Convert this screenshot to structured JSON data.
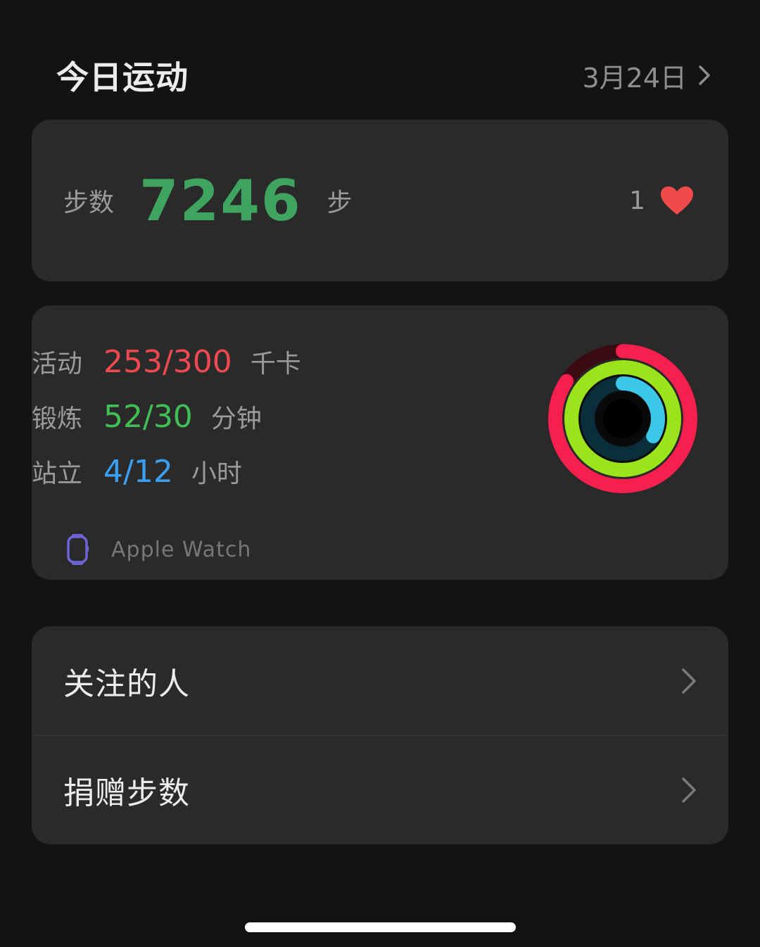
{
  "header": {
    "title": "今日运动",
    "date": "3月24日"
  },
  "steps": {
    "label": "步数",
    "value": "7246",
    "unit": "步",
    "likes": "1"
  },
  "activity": {
    "move": {
      "label": "活动",
      "value": "253/300",
      "unit": "千卡",
      "current": 253,
      "goal": 300,
      "color": "#f0494f"
    },
    "exercise": {
      "label": "锻炼",
      "value": "52/30",
      "unit": "分钟",
      "current": 52,
      "goal": 30,
      "color": "#3fbf55"
    },
    "stand": {
      "label": "站立",
      "value": "4/12",
      "unit": "小时",
      "current": 4,
      "goal": 12,
      "color": "#3b9ff0"
    },
    "source": {
      "icon": "watch-icon",
      "label": "Apple Watch"
    }
  },
  "list": {
    "follow": "关注的人",
    "donate": "捐赠步数"
  },
  "colors": {
    "background": "#131313",
    "card": "#2a2a2a",
    "steps_green": "#3fa45f",
    "heart": "#f04a4a"
  }
}
